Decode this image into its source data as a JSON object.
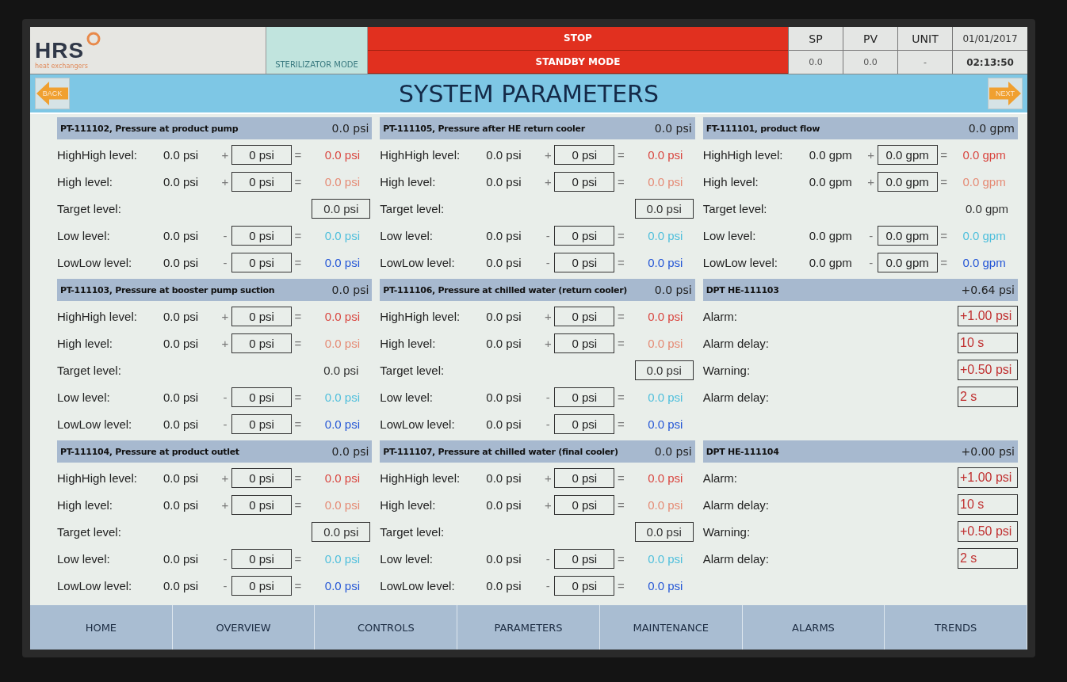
{
  "header": {
    "logo": {
      "name": "HRS",
      "tagline": "heat exchangers"
    },
    "mode": "STERILIZATOR MODE",
    "status": [
      "STOP",
      "STANDBY MODE"
    ],
    "readouts": [
      {
        "label": "SP",
        "value": "0.0"
      },
      {
        "label": "PV",
        "value": "0.0"
      },
      {
        "label": "UNIT",
        "value": "-"
      }
    ],
    "date": "01/01/2017",
    "time": "02:13:50"
  },
  "title_bar": {
    "back": "BACK",
    "title": "SYSTEM PARAMETERS",
    "next": "NEXT"
  },
  "columns": [
    [
      {
        "title": "PT-111102, Pressure at product pump",
        "value": "0.0 psi",
        "rows": [
          {
            "kind": "limit",
            "label": "HighHigh level:",
            "base": "0.0 psi",
            "sign": "+",
            "offset": "0 psi",
            "equals": "=",
            "result": "0.0 psi",
            "color": "#d9453f"
          },
          {
            "kind": "limit",
            "label": "High level:",
            "base": "0.0 psi",
            "sign": "+",
            "offset": "0 psi",
            "equals": "=",
            "result": "0.0 psi",
            "color": "#e58a74"
          },
          {
            "kind": "target",
            "label": "Target level:",
            "value": "0.0 psi",
            "boxed": true
          },
          {
            "kind": "limit",
            "label": "Low level:",
            "base": "0.0 psi",
            "sign": "-",
            "offset": "0 psi",
            "equals": "=",
            "result": "0.0 psi",
            "color": "#4fbfdc"
          },
          {
            "kind": "limit",
            "label": "LowLow level:",
            "base": "0.0 psi",
            "sign": "-",
            "offset": "0 psi",
            "equals": "=",
            "result": "0.0 psi",
            "color": "#2456d6"
          }
        ]
      },
      {
        "title": "PT-111103, Pressure at booster pump suction",
        "value": "0.0 psi",
        "rows": [
          {
            "kind": "limit",
            "label": "HighHigh level:",
            "base": "0.0 psi",
            "sign": "+",
            "offset": "0 psi",
            "equals": "=",
            "result": "0.0 psi",
            "color": "#d9453f"
          },
          {
            "kind": "limit",
            "label": "High level:",
            "base": "0.0 psi",
            "sign": "+",
            "offset": "0 psi",
            "equals": "=",
            "result": "0.0 psi",
            "color": "#e58a74"
          },
          {
            "kind": "target",
            "label": "Target level:",
            "value": "0.0 psi",
            "boxed": false
          },
          {
            "kind": "limit",
            "label": "Low level:",
            "base": "0.0 psi",
            "sign": "-",
            "offset": "0 psi",
            "equals": "=",
            "result": "0.0 psi",
            "color": "#4fbfdc"
          },
          {
            "kind": "limit",
            "label": "LowLow level:",
            "base": "0.0 psi",
            "sign": "-",
            "offset": "0 psi",
            "equals": "=",
            "result": "0.0 psi",
            "color": "#2456d6"
          }
        ]
      },
      {
        "title": "PT-111104, Pressure at product outlet",
        "value": "0.0 psi",
        "rows": [
          {
            "kind": "limit",
            "label": "HighHigh level:",
            "base": "0.0 psi",
            "sign": "+",
            "offset": "0 psi",
            "equals": "=",
            "result": "0.0 psi",
            "color": "#d9453f"
          },
          {
            "kind": "limit",
            "label": "High level:",
            "base": "0.0 psi",
            "sign": "+",
            "offset": "0 psi",
            "equals": "=",
            "result": "0.0 psi",
            "color": "#e58a74"
          },
          {
            "kind": "target",
            "label": "Target level:",
            "value": "0.0 psi",
            "boxed": true
          },
          {
            "kind": "limit",
            "label": "Low level:",
            "base": "0.0 psi",
            "sign": "-",
            "offset": "0 psi",
            "equals": "=",
            "result": "0.0 psi",
            "color": "#4fbfdc"
          },
          {
            "kind": "limit",
            "label": "LowLow level:",
            "base": "0.0 psi",
            "sign": "-",
            "offset": "0 psi",
            "equals": "=",
            "result": "0.0 psi",
            "color": "#2456d6"
          }
        ]
      }
    ],
    [
      {
        "title": "PT-111105, Pressure after HE return cooler",
        "value": "0.0 psi",
        "rows": [
          {
            "kind": "limit",
            "label": "HighHigh level:",
            "base": "0.0 psi",
            "sign": "+",
            "offset": "0 psi",
            "equals": "=",
            "result": "0.0 psi",
            "color": "#d9453f"
          },
          {
            "kind": "limit",
            "label": "High level:",
            "base": "0.0 psi",
            "sign": "+",
            "offset": "0 psi",
            "equals": "=",
            "result": "0.0 psi",
            "color": "#e58a74"
          },
          {
            "kind": "target",
            "label": "Target level:",
            "value": "0.0 psi",
            "boxed": true
          },
          {
            "kind": "limit",
            "label": "Low level:",
            "base": "0.0 psi",
            "sign": "-",
            "offset": "0 psi",
            "equals": "=",
            "result": "0.0 psi",
            "color": "#4fbfdc"
          },
          {
            "kind": "limit",
            "label": "LowLow level:",
            "base": "0.0 psi",
            "sign": "-",
            "offset": "0 psi",
            "equals": "=",
            "result": "0.0 psi",
            "color": "#2456d6"
          }
        ]
      },
      {
        "title": "PT-111106, Pressure at chilled water (return cooler)",
        "value": "0.0 psi",
        "rows": [
          {
            "kind": "limit",
            "label": "HighHigh level:",
            "base": "0.0 psi",
            "sign": "+",
            "offset": "0 psi",
            "equals": "=",
            "result": "0.0 psi",
            "color": "#d9453f"
          },
          {
            "kind": "limit",
            "label": "High level:",
            "base": "0.0 psi",
            "sign": "+",
            "offset": "0 psi",
            "equals": "=",
            "result": "0.0 psi",
            "color": "#e58a74"
          },
          {
            "kind": "target",
            "label": "Target level:",
            "value": "0.0 psi",
            "boxed": true
          },
          {
            "kind": "limit",
            "label": "Low level:",
            "base": "0.0 psi",
            "sign": "-",
            "offset": "0 psi",
            "equals": "=",
            "result": "0.0 psi",
            "color": "#4fbfdc"
          },
          {
            "kind": "limit",
            "label": "LowLow level:",
            "base": "0.0 psi",
            "sign": "-",
            "offset": "0 psi",
            "equals": "=",
            "result": "0.0 psi",
            "color": "#2456d6"
          }
        ]
      },
      {
        "title": "PT-111107, Pressure at chilled water (final cooler)",
        "value": "0.0 psi",
        "rows": [
          {
            "kind": "limit",
            "label": "HighHigh level:",
            "base": "0.0 psi",
            "sign": "+",
            "offset": "0 psi",
            "equals": "=",
            "result": "0.0 psi",
            "color": "#d9453f"
          },
          {
            "kind": "limit",
            "label": "High level:",
            "base": "0.0 psi",
            "sign": "+",
            "offset": "0 psi",
            "equals": "=",
            "result": "0.0 psi",
            "color": "#e58a74"
          },
          {
            "kind": "target",
            "label": "Target level:",
            "value": "0.0 psi",
            "boxed": true
          },
          {
            "kind": "limit",
            "label": "Low level:",
            "base": "0.0 psi",
            "sign": "-",
            "offset": "0 psi",
            "equals": "=",
            "result": "0.0 psi",
            "color": "#4fbfdc"
          },
          {
            "kind": "limit",
            "label": "LowLow level:",
            "base": "0.0 psi",
            "sign": "-",
            "offset": "0 psi",
            "equals": "=",
            "result": "0.0 psi",
            "color": "#2456d6"
          }
        ]
      }
    ],
    [
      {
        "title": "FT-111101, product flow",
        "value": "0.0 gpm",
        "rows": [
          {
            "kind": "limit",
            "label": "HighHigh level:",
            "base": "0.0 gpm",
            "sign": "+",
            "offset": "0.0 gpm",
            "equals": "=",
            "result": "0.0 gpm",
            "color": "#d9453f"
          },
          {
            "kind": "limit",
            "label": "High level:",
            "base": "0.0 gpm",
            "sign": "+",
            "offset": "0.0 gpm",
            "equals": "=",
            "result": "0.0 gpm",
            "color": "#e58a74"
          },
          {
            "kind": "target",
            "label": "Target level:",
            "value": "0.0 gpm",
            "boxed": false
          },
          {
            "kind": "limit",
            "label": "Low level:",
            "base": "0.0 gpm",
            "sign": "-",
            "offset": "0.0 gpm",
            "equals": "=",
            "result": "0.0 gpm",
            "color": "#4fbfdc"
          },
          {
            "kind": "limit",
            "label": "LowLow level:",
            "base": "0.0 gpm",
            "sign": "-",
            "offset": "0.0 gpm",
            "equals": "=",
            "result": "0.0 gpm",
            "color": "#2456d6"
          }
        ]
      },
      {
        "title": "DPT HE-111103",
        "value": "+0.64 psi",
        "rows": [
          {
            "kind": "setting",
            "label": "Alarm:",
            "value": "+1.00 psi"
          },
          {
            "kind": "setting",
            "label": "Alarm delay:",
            "value": "10 s"
          },
          {
            "kind": "setting",
            "label": "Warning:",
            "value": "+0.50 psi"
          },
          {
            "kind": "setting",
            "label": "Alarm delay:",
            "value": "2 s"
          }
        ]
      },
      {
        "title": "DPT HE-111104",
        "value": "+0.00 psi",
        "rows": [
          {
            "kind": "setting",
            "label": "Alarm:",
            "value": "+1.00 psi"
          },
          {
            "kind": "setting",
            "label": "Alarm delay:",
            "value": "10 s"
          },
          {
            "kind": "setting",
            "label": "Warning:",
            "value": "+0.50 psi"
          },
          {
            "kind": "setting",
            "label": "Alarm delay:",
            "value": "2 s"
          }
        ]
      }
    ]
  ],
  "nav": [
    "HOME",
    "OVERVIEW",
    "CONTROLS",
    "PARAMETERS",
    "MAINTENANCE",
    "ALARMS",
    "TRENDS"
  ]
}
